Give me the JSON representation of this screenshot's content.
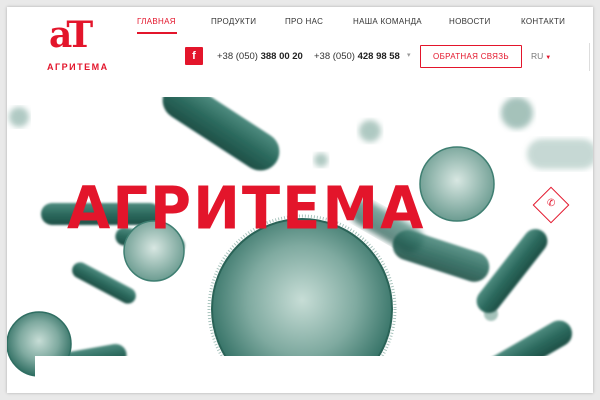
{
  "brand": {
    "logo_mark": "аТ",
    "logo_text": "АГРИТЕМА",
    "accent_color": "#e3152b"
  },
  "nav": {
    "items": [
      {
        "label": "ГЛАВНАЯ",
        "active": true
      },
      {
        "label": "ПРОДУКТИ",
        "active": false
      },
      {
        "label": "ПРО НАС",
        "active": false
      },
      {
        "label": "НАША КОМАНДА",
        "active": false
      },
      {
        "label": "НОВОСТИ",
        "active": false
      },
      {
        "label": "КОНТАКТИ",
        "active": false
      }
    ]
  },
  "contacts": {
    "facebook_icon": "facebook-icon",
    "phone1_prefix": "+38 (050)",
    "phone1_number": "388 00 20",
    "phone2_prefix": "+38 (050)",
    "phone2_number": "428 98 58",
    "phones_dropdown_icon": "chevron-down-icon",
    "callback_label": "ОБРАТНАЯ СВЯЗЬ",
    "language": "RU",
    "language_icon": "caret-down-icon"
  },
  "hero": {
    "title": "АГРИТЕМА",
    "side_button_icon": "phone-icon"
  }
}
